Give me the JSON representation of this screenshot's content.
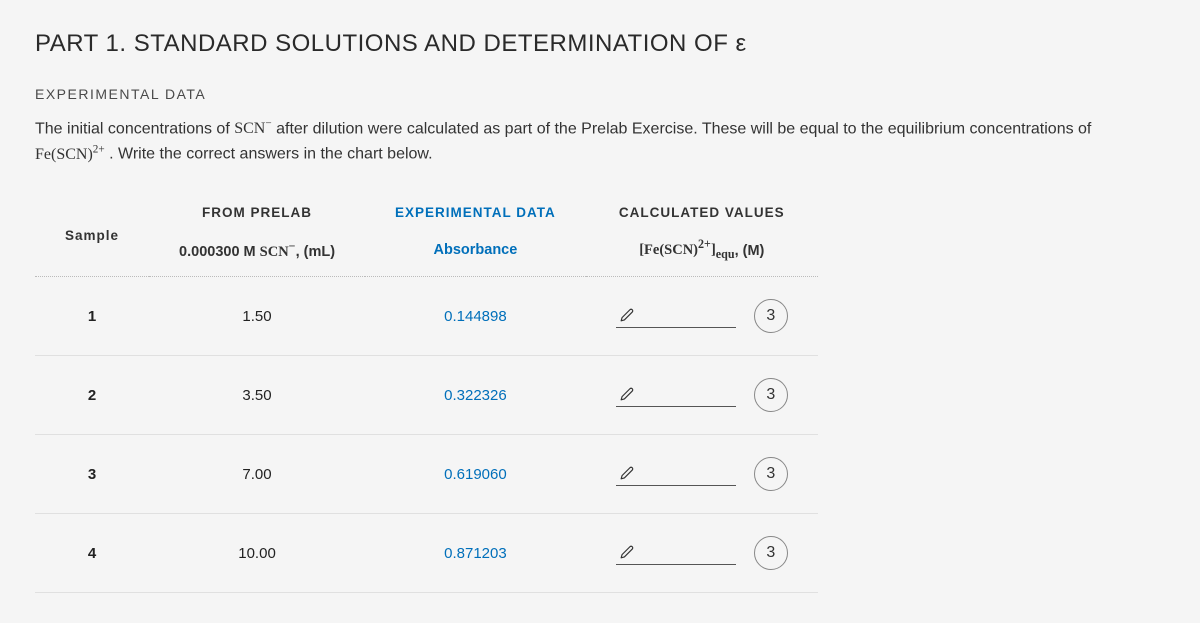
{
  "title": "PART 1. STANDARD SOLUTIONS AND DETERMINATION OF ε",
  "subheader": "EXPERIMENTAL DATA",
  "intro_before": "The initial concentrations of ",
  "intro_species1_html": "SCN⁻",
  "intro_mid": " after dilution were calculated as part of the Prelab Exercise. These will be equal to the equilibrium concentrations of ",
  "intro_species2_html": "Fe(SCN)²⁺",
  "intro_after": ". Write the correct answers in the chart below.",
  "headers": {
    "sample": "Sample",
    "group_prelab": "FROM PRELAB",
    "group_exp": "EXPERIMENTAL DATA",
    "group_calc": "CALCULATED VALUES",
    "sub_prelab_prefix": "0.000300 M ",
    "sub_prelab_species": "SCN⁻",
    "sub_prelab_suffix": ", (mL)",
    "sub_exp": "Absorbance",
    "sub_calc_prefix": "[Fe(SCN)²⁺]",
    "sub_calc_suffix_sub": "equ",
    "sub_calc_suffix": ", (M)"
  },
  "rows": [
    {
      "sample": "1",
      "prelab": "1.50",
      "absorbance": "0.144898",
      "calc": "",
      "attempts": "3"
    },
    {
      "sample": "2",
      "prelab": "3.50",
      "absorbance": "0.322326",
      "calc": "",
      "attempts": "3"
    },
    {
      "sample": "3",
      "prelab": "7.00",
      "absorbance": "0.619060",
      "calc": "",
      "attempts": "3"
    },
    {
      "sample": "4",
      "prelab": "10.00",
      "absorbance": "0.871203",
      "calc": "",
      "attempts": "3"
    }
  ]
}
